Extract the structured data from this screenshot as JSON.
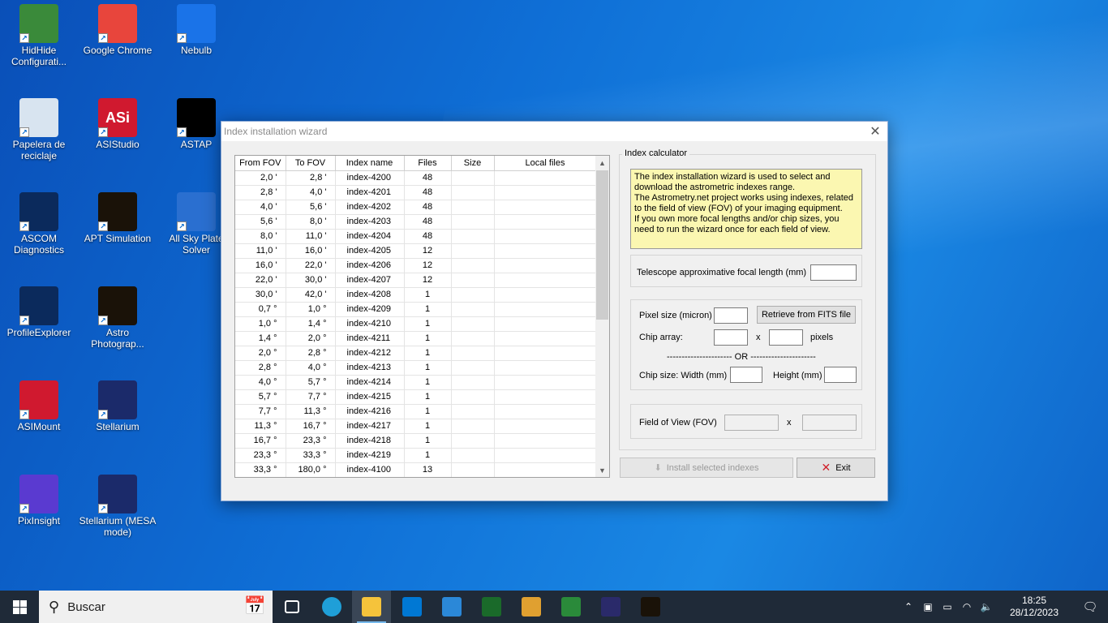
{
  "desktop": {
    "icons": [
      {
        "label": "HidHide Configurati...",
        "color": "#3a8a3a"
      },
      {
        "label": "Google Chrome",
        "color": "#e8453c"
      },
      {
        "label": "Nebulb",
        "color": "#1a73e8"
      },
      {
        "label": "Papelera de reciclaje",
        "color": "#d8e4f0"
      },
      {
        "label": "ASIStudio",
        "color": "#d0192f",
        "glyph": "ASi"
      },
      {
        "label": "ASTAP",
        "color": "#000000"
      },
      {
        "label": "ASCOM Diagnostics",
        "color": "#0b2a5c"
      },
      {
        "label": "APT Simulation",
        "color": "#1a1208"
      },
      {
        "label": "All Sky Plate Solver",
        "color": "#2a6fd0"
      },
      {
        "label": "ProfileExplorer",
        "color": "#0b2a5c"
      },
      {
        "label": "Astro Photograp...",
        "color": "#1a1208"
      },
      {
        "label": "ASIMount",
        "color": "#d0192f"
      },
      {
        "label": "Stellarium",
        "color": "#1b2a6a"
      },
      {
        "label": "PixInsight",
        "color": "#5a3ad0"
      },
      {
        "label": "Stellarium (MESA mode)",
        "color": "#1b2a6a"
      }
    ]
  },
  "wizard": {
    "title": "Index installation wizard",
    "close_glyph": "✕",
    "table": {
      "headers": [
        "From FOV",
        "To FOV",
        "Index name",
        "Files",
        "Size",
        "Local files"
      ],
      "rows": [
        [
          "2,0  '",
          "2,8  '",
          "index-4200",
          "48"
        ],
        [
          "2,8  '",
          "4,0  '",
          "index-4201",
          "48"
        ],
        [
          "4,0  '",
          "5,6  '",
          "index-4202",
          "48"
        ],
        [
          "5,6  '",
          "8,0  '",
          "index-4203",
          "48"
        ],
        [
          "8,0  '",
          "11,0  '",
          "index-4204",
          "48"
        ],
        [
          "11,0  '",
          "16,0  '",
          "index-4205",
          "12"
        ],
        [
          "16,0  '",
          "22,0  '",
          "index-4206",
          "12"
        ],
        [
          "22,0  '",
          "30,0  '",
          "index-4207",
          "12"
        ],
        [
          "30,0  '",
          "42,0  '",
          "index-4208",
          "1"
        ],
        [
          "0,7  °",
          "1,0  °",
          "index-4209",
          "1"
        ],
        [
          "1,0  °",
          "1,4  °",
          "index-4210",
          "1"
        ],
        [
          "1,4  °",
          "2,0  °",
          "index-4211",
          "1"
        ],
        [
          "2,0  °",
          "2,8  °",
          "index-4212",
          "1"
        ],
        [
          "2,8  °",
          "4,0  °",
          "index-4213",
          "1"
        ],
        [
          "4,0  °",
          "5,7  °",
          "index-4214",
          "1"
        ],
        [
          "5,7  °",
          "7,7  °",
          "index-4215",
          "1"
        ],
        [
          "7,7  °",
          "11,3  °",
          "index-4216",
          "1"
        ],
        [
          "11,3  °",
          "16,7  °",
          "index-4217",
          "1"
        ],
        [
          "16,7  °",
          "23,3  °",
          "index-4218",
          "1"
        ],
        [
          "23,3  °",
          "33,3  °",
          "index-4219",
          "1"
        ],
        [
          "33,3  °",
          "180,0  °",
          "index-4100",
          "13"
        ]
      ]
    },
    "calculator": {
      "group_label": "Index calculator",
      "info_text": "The index installation wizard is used to select and download the astrometric indexes range.\nThe Astrometry.net project works using indexes, related to the field of view (FOV) of your imaging equipment.\nIf you own more focal lengths and/or chip sizes, you need to run the wizard once for each field of view.",
      "focal_label": "Telescope approximative focal length (mm)",
      "focal_value": "",
      "pixel_label": "Pixel size (micron)",
      "pixel_value": "",
      "retrieve_label": "Retrieve from FITS file",
      "chip_array_label": "Chip array:",
      "chip_x_sep": "x",
      "pixels_label": "pixels",
      "or_label": "---------------------- OR ----------------------",
      "chip_size_label": "Chip size:  Width (mm)",
      "height_label": "Height (mm)",
      "fov_label": "Field of View  (FOV)",
      "fov_x_sep": "x",
      "install_label": "Install selected indexes",
      "exit_label": "Exit"
    }
  },
  "taskbar": {
    "search_placeholder": "Buscar",
    "apps": [
      {
        "name": "task-view",
        "color": "#ffffff"
      },
      {
        "name": "edge",
        "color": "#1f9fd8"
      },
      {
        "name": "file-explorer",
        "color": "#f5c33b",
        "active": true
      },
      {
        "name": "store",
        "color": "#0078d4"
      },
      {
        "name": "mail",
        "color": "#2b88d8"
      },
      {
        "name": "app-green",
        "color": "#1a6a2a"
      },
      {
        "name": "paint",
        "color": "#e0a030"
      },
      {
        "name": "spreadsheet",
        "color": "#2a8a3a"
      },
      {
        "name": "stellarium",
        "color": "#2a2a6a"
      },
      {
        "name": "apt",
        "color": "#1a1208"
      }
    ],
    "time": "18:25",
    "date": "28/12/2023"
  }
}
